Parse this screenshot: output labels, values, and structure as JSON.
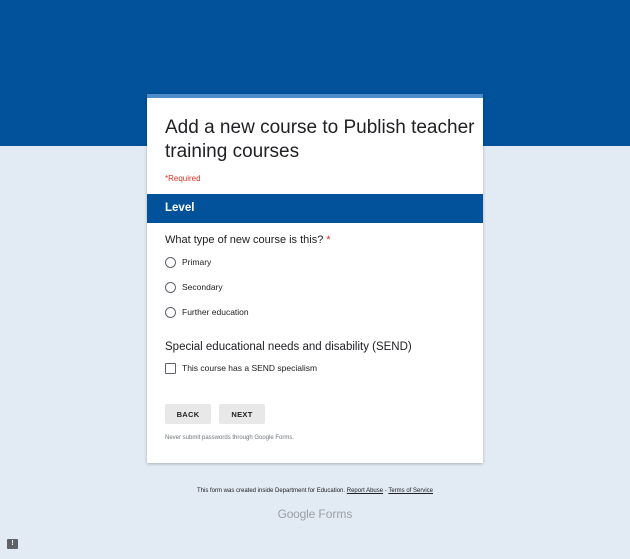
{
  "form": {
    "title": "Add a new course to Publish teacher training courses",
    "required_note": "*Required"
  },
  "section": {
    "title": "Level"
  },
  "question1": {
    "title": "What type of new course is this?",
    "required_marker": "*",
    "options": [
      {
        "label": "Primary",
        "selected": false
      },
      {
        "label": "Secondary",
        "selected": false
      },
      {
        "label": "Further education",
        "selected": false
      }
    ]
  },
  "question2": {
    "title": "Special educational needs and disability (SEND)",
    "checkbox_label": "This course has a SEND specialism",
    "checked": false
  },
  "buttons": {
    "back": "BACK",
    "next": "NEXT"
  },
  "password_note": "Never submit passwords through Google Forms.",
  "footer": {
    "created_text": "This form was created inside Department for Education.",
    "report_abuse": "Report Abuse",
    "separator": "-",
    "terms": "Terms of Service",
    "logo_google": "Google",
    "logo_forms": "Forms"
  },
  "icons": {
    "report": "report-icon"
  },
  "colors": {
    "header_blue": "#01529b",
    "page_background": "#e2ebf4",
    "required_red": "#d93025"
  }
}
